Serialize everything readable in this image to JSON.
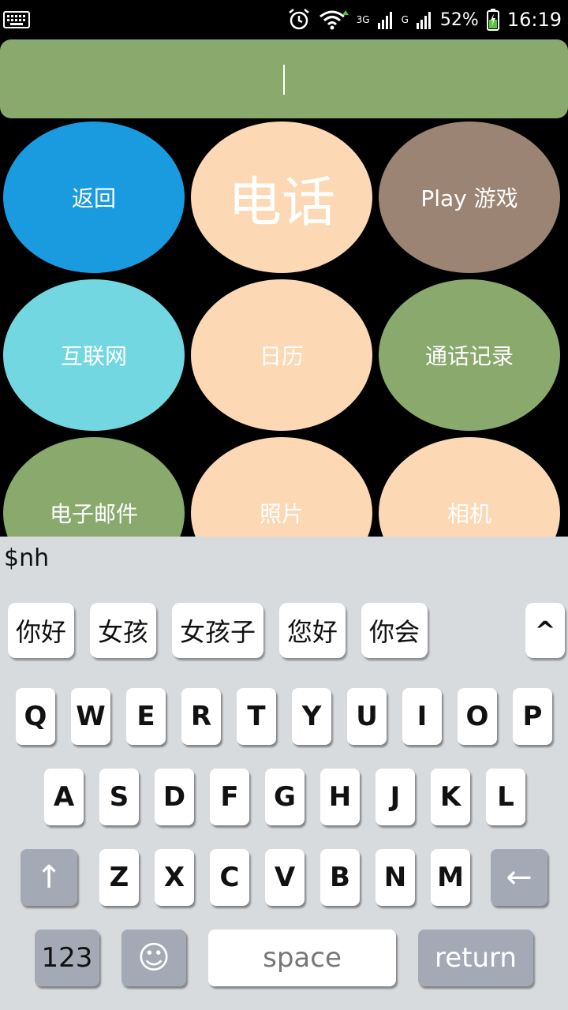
{
  "status_bar": {
    "network_3g": "3G",
    "network_g": "G",
    "battery": "52%",
    "time": "16:19"
  },
  "search": {
    "value": ""
  },
  "apps": [
    {
      "label": "返回",
      "color": "#1a9be0"
    },
    {
      "label": "电话",
      "color": "#fcd9b4"
    },
    {
      "label": "Play 游戏",
      "color": "#9b8474"
    },
    {
      "label": "互联网",
      "color": "#72d7e0"
    },
    {
      "label": "日历",
      "color": "#fcd9b4"
    },
    {
      "label": "通话记录",
      "color": "#89a96d"
    },
    {
      "label": "电子邮件",
      "color": "#89a96d"
    },
    {
      "label": "照片",
      "color": "#fcd9b4"
    },
    {
      "label": "相机",
      "color": "#fcd9b4"
    }
  ],
  "compose_text": "$nh",
  "keyboard": {
    "candidates": [
      "你好",
      "女孩",
      "女孩子",
      "您好",
      "你会"
    ],
    "expand": "^",
    "row1": [
      "Q",
      "W",
      "E",
      "R",
      "T",
      "Y",
      "U",
      "I",
      "O",
      "P"
    ],
    "row2": [
      "A",
      "S",
      "D",
      "F",
      "G",
      "H",
      "J",
      "K",
      "L"
    ],
    "row3": [
      "Z",
      "X",
      "C",
      "V",
      "B",
      "N",
      "M"
    ],
    "shift": "↑",
    "backspace": "←",
    "numbers": "123",
    "emoji": "☺",
    "space": "space",
    "return": "return"
  }
}
